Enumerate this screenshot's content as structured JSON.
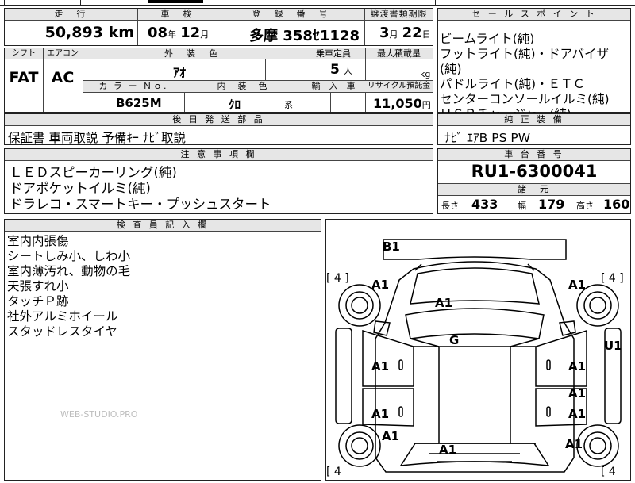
{
  "top_row": {
    "mileage_label": "走　行",
    "mileage": "50,893",
    "mileage_unit": "km",
    "inspection_label": "車　検",
    "inspection_year": "08",
    "year_unit": "年",
    "inspection_month": "12",
    "month_unit": "月",
    "registration_label": "登　録　番　号",
    "registration_number": "多摩 358ｾ1128",
    "transfer_deadline_label": "譲渡書類期限",
    "transfer_month": "3",
    "transfer_month_unit": "月",
    "transfer_day": "22",
    "transfer_day_unit": "日"
  },
  "row2": {
    "shift_label": "シフト",
    "aircon_label": "エアコン",
    "exterior_color_label": "外　装　色",
    "capacity_label": "乗車定員",
    "max_load_label": "最大積載量",
    "shift": "FAT",
    "aircon": "AC",
    "exterior_color": "ｱｵ",
    "capacity": "5",
    "capacity_unit": "人",
    "load_unit": "kg",
    "color_no_label": "カ ラ ー Ｎｏ.",
    "interior_color_label": "内　装　色",
    "import_label": "輸　入　車",
    "recycle_label": "リサイクル預託金",
    "color_no": "B625M",
    "interior_color": "ｸﾛ",
    "interior_suffix": "系",
    "recycle_fee": "11,050",
    "recycle_unit": "円"
  },
  "sales_points": {
    "header": "セ ー ル ス ポ イ ン ト",
    "items": [
      "ビームライト(純)",
      "フットライト(純)・ドアバイザ(純)",
      "パドルライト(純)・ＥＴＣ",
      "センターコンソールイルミ(純)",
      "ＵＳＢチャージャー(純)"
    ]
  },
  "delivery_parts": {
    "header": "後 日 発 送 部 品",
    "text": "保証書 車両取説 予備ｷｰ ﾅﾋﾞ取説"
  },
  "genuine_equipment": {
    "header": "純 正 装 備",
    "text": "ﾅﾋﾞ ｴｱB PS PW"
  },
  "notes": {
    "header": "注 意 事 項 欄",
    "items": [
      "ＬＥＤスピーカーリング(純)",
      "ドアポケットイルミ(純)",
      "ドラレコ・スマートキー・プッシュスタート"
    ]
  },
  "chassis": {
    "header": "車 台 番 号",
    "number": "RU1-6300041"
  },
  "specs": {
    "header": "諸　元",
    "length_label": "長さ",
    "length": "433",
    "width_label": "幅",
    "width": "179",
    "height_label": "高さ",
    "height": "160"
  },
  "inspector": {
    "header": "検 査 員 記 入 欄",
    "items": [
      "室内内張傷",
      "シートしみ小、しわ小",
      "室内薄汚れ、動物の毛",
      "天張すれ小",
      "タッチＰ跡",
      "社外アルミホイール",
      "スタッドレスタイヤ"
    ],
    "watermark": "WEB-STUDIO.PRO"
  },
  "diagram": {
    "marks": [
      "B1",
      "A1",
      "A1",
      "A1",
      "G",
      "U1",
      "A1",
      "A1",
      "A1",
      "A1",
      "A1",
      "A1",
      "A1",
      "A1"
    ],
    "tire_left_top": "[ 4 ]",
    "tire_right_top": "[ 4 ]",
    "tire_left_bottom": "[ 4",
    "tire_right_bottom": "[ 4"
  }
}
